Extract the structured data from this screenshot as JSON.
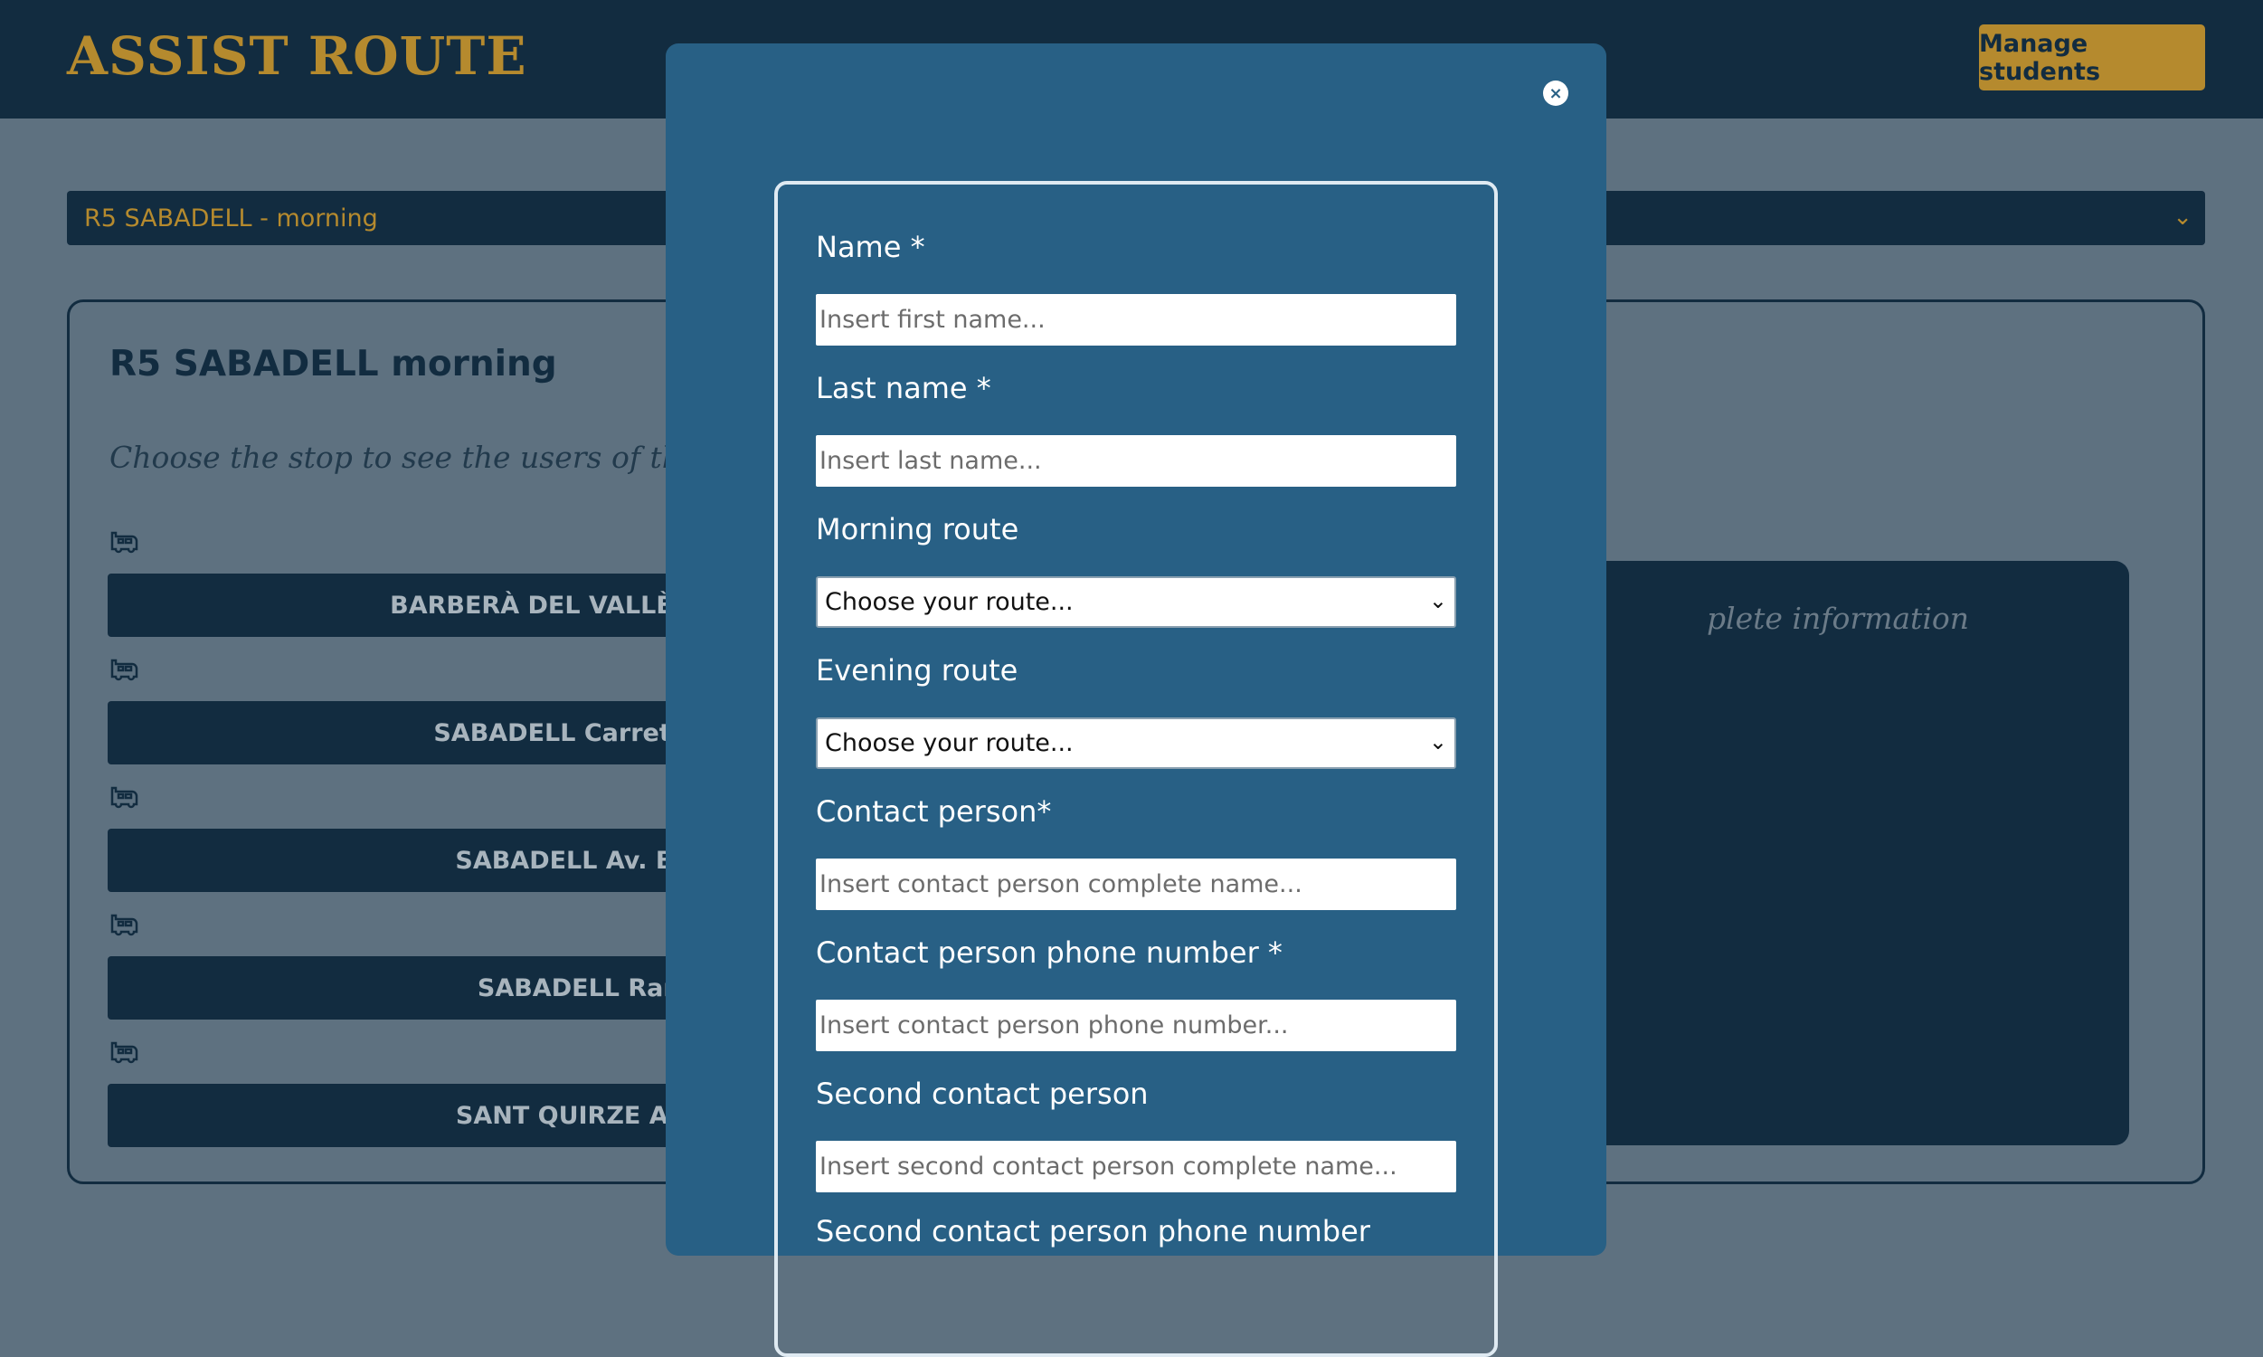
{
  "header": {
    "brand": "ASSIST ROUTE",
    "manage_students": "Manage students"
  },
  "route_selector": {
    "selected": "R5 SABADELL - morning"
  },
  "panel": {
    "title": "R5 SABADELL morning",
    "subtitle": "Choose the stop to see the users of the sto",
    "stops": [
      {
        "label": "BARBERÀ DEL VALLÈS Carrete"
      },
      {
        "label": "SABADELL Carretera de"
      },
      {
        "label": "SABADELL Av. Barbe"
      },
      {
        "label": "SABADELL Rambl"
      },
      {
        "label": "SANT QUIRZE Avd. C"
      }
    ],
    "info_text": "plete information"
  },
  "modal": {
    "close_symbol": "×",
    "fields": {
      "name_label": "Name *",
      "name_placeholder": "Insert first name...",
      "last_name_label": "Last name *",
      "last_name_placeholder": "Insert last name...",
      "morning_route_label": "Morning route",
      "morning_route_value": "Choose your route...",
      "evening_route_label": "Evening route",
      "evening_route_value": "Choose your route...",
      "contact_label": "Contact person*",
      "contact_placeholder": "Insert contact person complete name...",
      "contact_phone_label": "Contact person phone number *",
      "contact_phone_placeholder": "Insert contact person phone number...",
      "second_contact_label": "Second contact person",
      "second_contact_placeholder": "Insert second contact person complete name...",
      "second_contact_phone_label": "Second contact person phone number"
    }
  },
  "icons": {
    "bus": "bus-stop-icon",
    "chevron": "chevron-down-icon",
    "close": "close-icon"
  },
  "colors": {
    "header_bg": "#122c40",
    "accent": "#b58a2e",
    "modal_bg": "#286085",
    "overlay_bg": "#5e7180"
  }
}
